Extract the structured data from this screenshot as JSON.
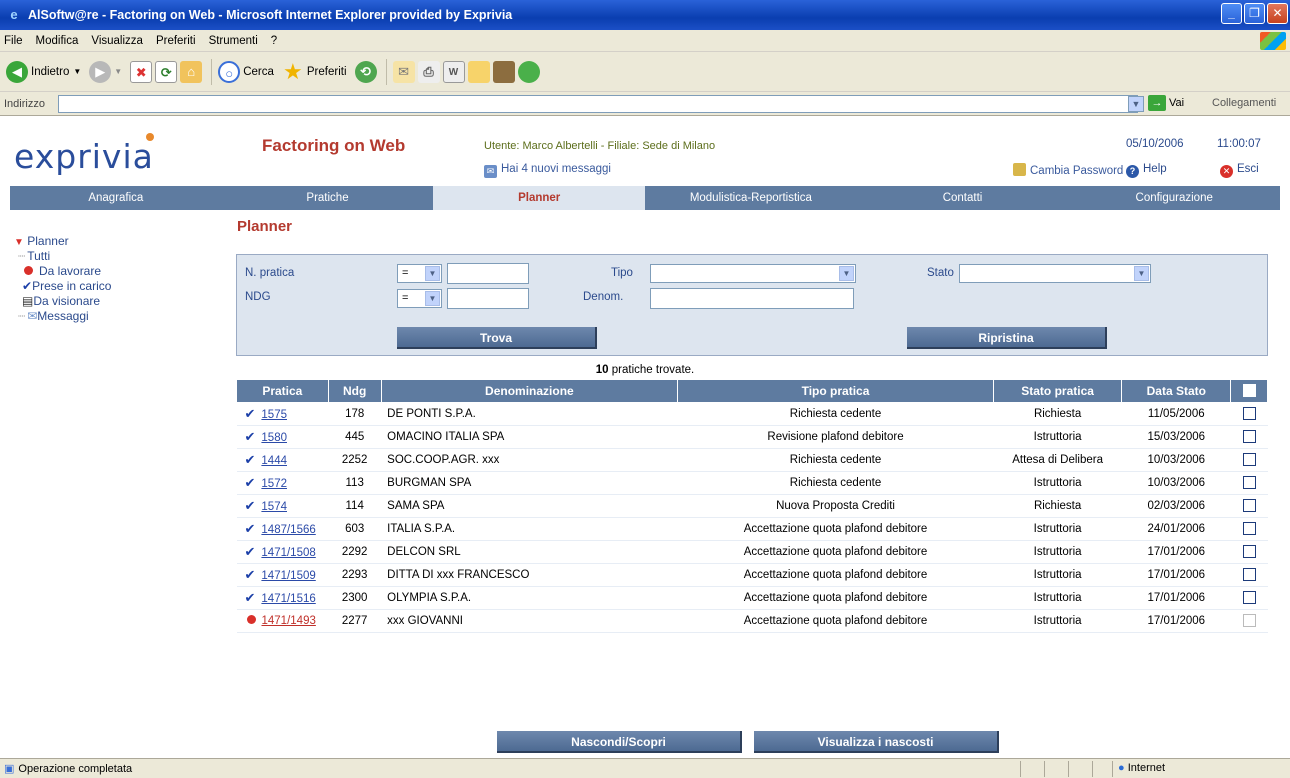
{
  "window": {
    "title": "AlSoftw@re - Factoring on Web - Microsoft Internet Explorer provided by Exprivia",
    "minimize": "_",
    "restore": "❐",
    "close": "✕"
  },
  "menu": [
    "File",
    "Modifica",
    "Visualizza",
    "Preferiti",
    "Strumenti",
    "?"
  ],
  "toolbar": {
    "back": "Indietro",
    "search": "Cerca",
    "favorites": "Preferiti"
  },
  "address": {
    "label": "Indirizzo",
    "value": "",
    "go": "Vai",
    "links": "Collegamenti"
  },
  "header": {
    "logo": "exprivia",
    "app_title": "Factoring on Web",
    "user_info": "Utente: Marco Albertelli - Filiale: Sede di Milano",
    "messages": "Hai 4 nuovi messaggi",
    "change_password": "Cambia Password",
    "date": "05/10/2006",
    "time": "11:00:07",
    "help": "Help",
    "exit": "Esci"
  },
  "nav": [
    "Anagrafica",
    "Pratiche",
    "Planner",
    "Modulistica-Reportistica",
    "Contatti",
    "Configurazione"
  ],
  "sidebar": {
    "root": "Planner",
    "items": [
      "Tutti",
      "Da lavorare",
      "Prese in carico",
      "Da visionare",
      "Messaggi"
    ]
  },
  "content": {
    "title": "Planner",
    "filters": {
      "n_pratica_label": "N. pratica",
      "ndg_label": "NDG",
      "operator": "=",
      "tipo_label": "Tipo",
      "stato_label": "Stato",
      "denom_label": "Denom.",
      "find": "Trova",
      "reset": "Ripristina"
    },
    "found_count": "10",
    "found_text": "pratiche trovate.",
    "columns": [
      "Pratica",
      "Ndg",
      "Denominazione",
      "Tipo pratica",
      "Stato pratica",
      "Data Stato"
    ],
    "rows": [
      {
        "pratica": "1575",
        "ndg": "178",
        "den": "DE PONTI S.P.A.",
        "tipo": "Richiesta cedente",
        "stato": "Richiesta",
        "data": "11/05/2006",
        "flag": "check"
      },
      {
        "pratica": "1580",
        "ndg": "445",
        "den": "OMACINO ITALIA SPA",
        "tipo": "Revisione plafond debitore",
        "stato": "Istruttoria",
        "data": "15/03/2006",
        "flag": "check"
      },
      {
        "pratica": "1444",
        "ndg": "2252",
        "den": "SOC.COOP.AGR. xxx",
        "tipo": "Richiesta cedente",
        "stato": "Attesa di Delibera",
        "data": "10/03/2006",
        "flag": "check"
      },
      {
        "pratica": "1572",
        "ndg": "113",
        "den": "BURGMAN SPA",
        "tipo": "Richiesta cedente",
        "stato": "Istruttoria",
        "data": "10/03/2006",
        "flag": "check"
      },
      {
        "pratica": "1574",
        "ndg": "114",
        "den": "SAMA SPA",
        "tipo": "Nuova Proposta Crediti",
        "stato": "Richiesta",
        "data": "02/03/2006",
        "flag": "check"
      },
      {
        "pratica": "1487/1566",
        "ndg": "603",
        "den": "ITALIA S.P.A.",
        "tipo": "Accettazione quota plafond debitore",
        "stato": "Istruttoria",
        "data": "24/01/2006",
        "flag": "check"
      },
      {
        "pratica": "1471/1508",
        "ndg": "2292",
        "den": "DELCON SRL",
        "tipo": "Accettazione quota plafond debitore",
        "stato": "Istruttoria",
        "data": "17/01/2006",
        "flag": "check"
      },
      {
        "pratica": "1471/1509",
        "ndg": "2293",
        "den": "DITTA DI xxx FRANCESCO",
        "tipo": "Accettazione quota plafond debitore",
        "stato": "Istruttoria",
        "data": "17/01/2006",
        "flag": "check"
      },
      {
        "pratica": "1471/1516",
        "ndg": "2300",
        "den": "OLYMPIA S.P.A.",
        "tipo": "Accettazione quota plafond debitore",
        "stato": "Istruttoria",
        "data": "17/01/2006",
        "flag": "check"
      },
      {
        "pratica": "1471/1493",
        "ndg": "2277",
        "den": "xxx GIOVANNI",
        "tipo": "Accettazione quota plafond debitore",
        "stato": "Istruttoria",
        "data": "17/01/2006",
        "flag": "dot"
      }
    ],
    "hide_show": "Nascondi/Scopri",
    "show_hidden": "Visualizza i nascosti"
  },
  "status": {
    "text": "Operazione completata",
    "zone": "Internet"
  },
  "colors": {
    "nav_bg": "#5e7ba0",
    "accent_red": "#b43a2f",
    "filter_bg": "#dde5ef"
  }
}
